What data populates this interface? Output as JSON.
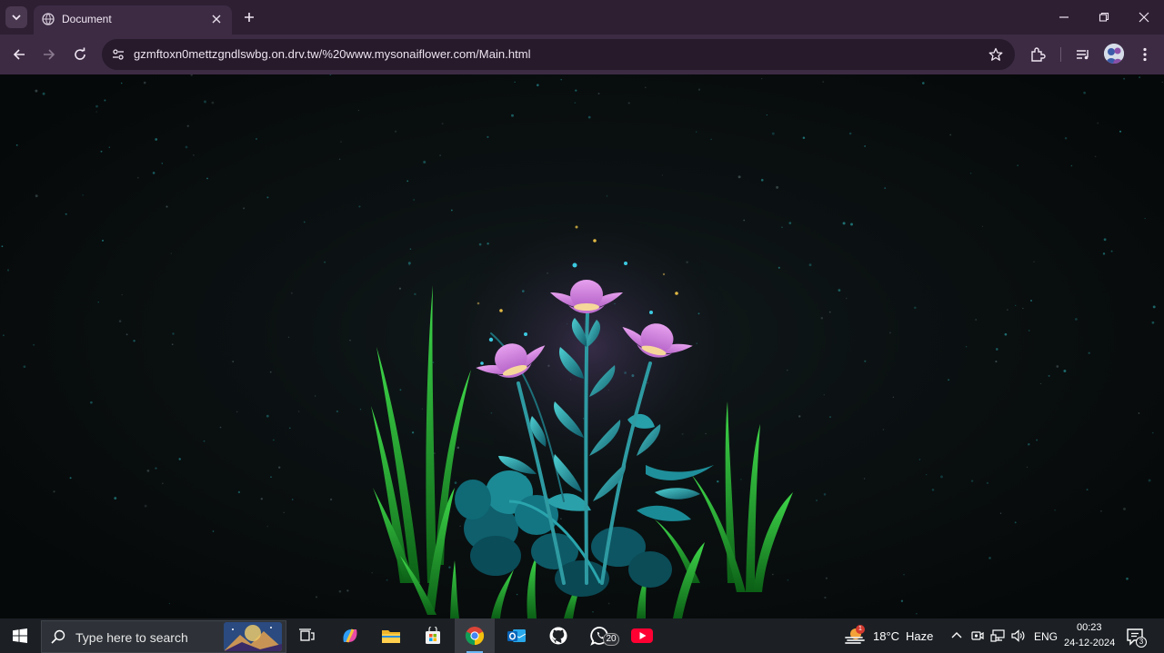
{
  "browser": {
    "tab": {
      "title": "Document"
    },
    "address_bar": {
      "url": "gzmftoxn0mettzgndlswbg.on.drv.tw/%20www.mysonaiflower.com/Main.html"
    },
    "icons": [
      "tab-search-icon",
      "globe-icon",
      "close-icon",
      "plus-icon",
      "minimize-icon",
      "maximize-icon",
      "close-window-icon",
      "back-icon",
      "forward-icon",
      "reload-icon",
      "site-info-icon",
      "star-icon",
      "extensions-icon",
      "media-icon",
      "avatar",
      "menu-icon"
    ]
  },
  "page": {
    "description_icons": [
      "flower-icon",
      "grass-icon",
      "leaf-icon",
      "star-icon"
    ]
  },
  "taskbar": {
    "search_placeholder": "Type here to search",
    "apps": [
      "task-view-icon",
      "copilot-icon",
      "file-explorer-icon",
      "store-icon",
      "chrome-icon",
      "outlook-icon",
      "github-icon",
      "whatsapp-icon",
      "youtube-icon"
    ],
    "whatsapp_badge": "20",
    "weather": {
      "temp": "18°C",
      "condition": "Haze",
      "alert_count": "1"
    },
    "language": "ENG",
    "time": "00:23",
    "date": "24-12-2024",
    "notification_count": "3",
    "colors": {
      "active_underline": "#6cb8f6",
      "taskbar_bg": "#1c2025"
    }
  }
}
